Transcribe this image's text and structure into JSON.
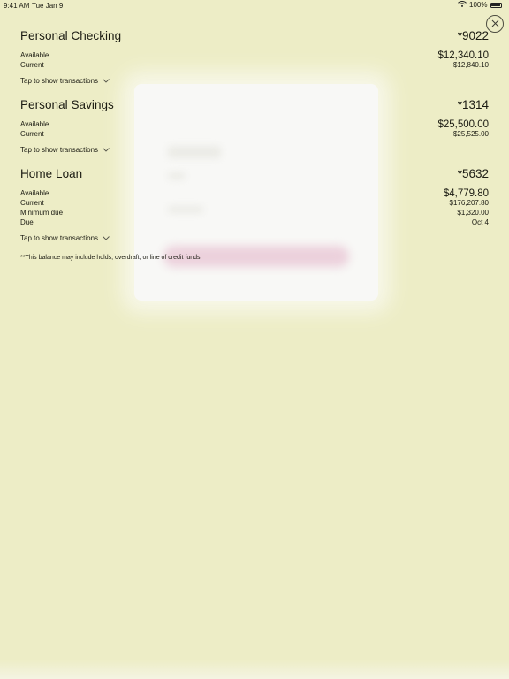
{
  "status_bar": {
    "time": "9:41 AM",
    "date": "Tue Jan 9",
    "battery": "100%"
  },
  "icons": {
    "close": "close-icon",
    "chevron": "chevron-down-icon",
    "wifi": "wifi-icon",
    "battery": "battery-icon"
  },
  "accounts": [
    {
      "name": "Personal Checking",
      "number": "*9022",
      "rows": [
        {
          "label": "Available",
          "value": "$12,340.10"
        },
        {
          "label": "Current",
          "value": "$12,840.10"
        }
      ],
      "toggle_label": "Tap to show transactions"
    },
    {
      "name": "Personal Savings",
      "number": "*1314",
      "rows": [
        {
          "label": "Available",
          "value": "$25,500.00"
        },
        {
          "label": "Current",
          "value": "$25,525.00"
        }
      ],
      "toggle_label": "Tap to show transactions"
    },
    {
      "name": "Home Loan",
      "number": "*5632",
      "rows": [
        {
          "label": "Available",
          "value": "$4,779.80"
        },
        {
          "label": "Current",
          "value": "$176,207.80"
        },
        {
          "label": "Minimum due",
          "value": "$1,320.00"
        },
        {
          "label": "Due",
          "value": "Oct 4"
        }
      ],
      "toggle_label": "Tap to show transactions"
    }
  ],
  "footnote": "**This balance may include holds, overdraft, or line of credit funds.",
  "colors": {
    "background": "#ededc6",
    "text": "#1b1b12"
  }
}
